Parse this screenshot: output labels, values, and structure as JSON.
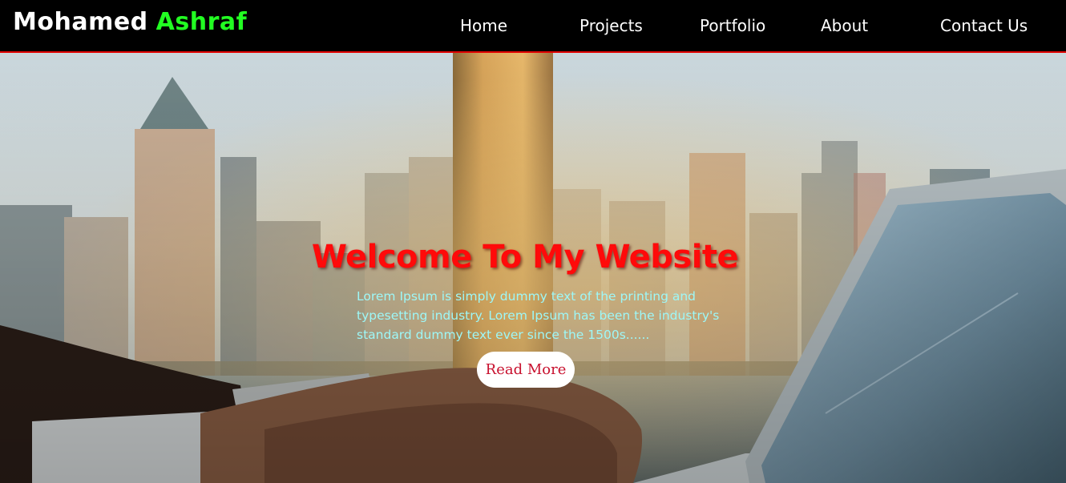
{
  "brand": {
    "first_name": "Mohamed",
    "last_name": "Ashraf",
    "first_color": "#ffffff",
    "last_color": "#22ff22"
  },
  "nav": {
    "items": [
      {
        "label": "Home"
      },
      {
        "label": "Projects"
      },
      {
        "label": "Portfolio"
      },
      {
        "label": "About"
      },
      {
        "label": "Contact Us"
      }
    ],
    "background": "#000000",
    "border_color": "#e00000"
  },
  "hero": {
    "title": "Welcome To My Website",
    "title_color": "#ff0a0a",
    "text": "Lorem Ipsum is simply dummy text of the printing and typesetting industry. Lorem Ipsum has been the industry's standard dummy text ever since the 1500s......",
    "text_color": "#9df7f7",
    "button_label": "Read More",
    "button_text_color": "#c8102e",
    "background_image": "city-skyline-office-laptop-photo"
  }
}
